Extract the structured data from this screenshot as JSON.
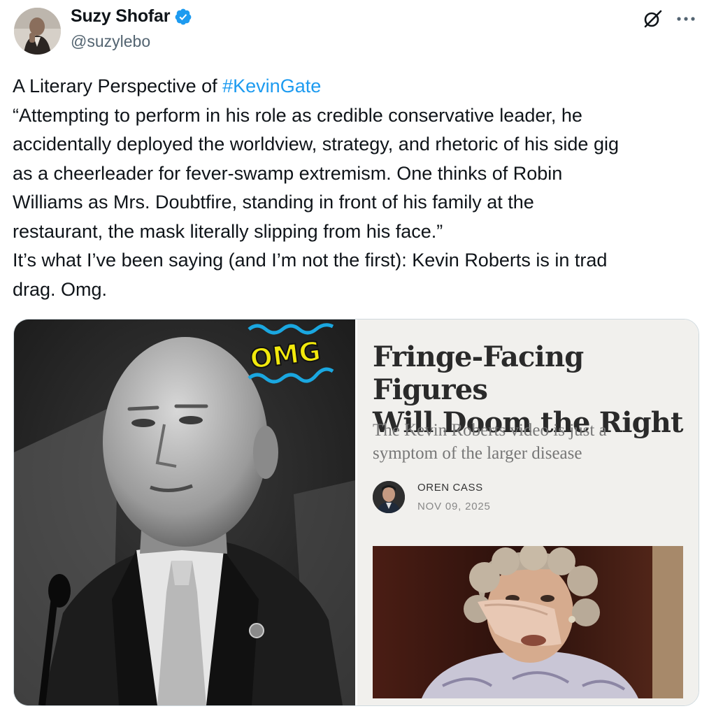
{
  "author": {
    "name": "Suzy Shofar",
    "handle": "@suzylebo",
    "avatar_icon": "avatar-photo",
    "verified_icon": "verified-badge-icon",
    "verified_color": "#1d9bf0"
  },
  "header_actions": {
    "grok_icon": "grok-icon",
    "more_icon": "more-options-icon"
  },
  "tweet": {
    "line1_prefix": "A Literary Perspective of ",
    "hashtag": "#KevinGate",
    "lines": [
      "“Attempting to perform in his role as credible conservative leader, he",
      "accidentally deployed the worldview, strategy, and rhetoric of his side gig",
      "as a cheerleader for fever-swamp extremism. One thinks of Robin",
      "Williams as Mrs. Doubtfire, standing in front of his family at the",
      "restaurant, the mask literally slipping from his face.”",
      "It’s what I’ve been saying (and I’m not the first): Kevin Roberts is in trad",
      "drag. Omg."
    ],
    "hashtag_color": "#1d9bf0"
  },
  "media": {
    "left_image": "grayscale-photo-man-at-podium",
    "omg_sticker": "OMG",
    "article": {
      "title_line1": "Fringe-Facing Figures",
      "title_line2": "Will Doom the Right",
      "subtitle_line1": "The Kevin Roberts video is just a",
      "subtitle_line2": "symptom of the larger disease",
      "author": "OREN CASS",
      "date": "NOV 09, 2025",
      "photo": "mrs-doubtfire-still"
    }
  }
}
